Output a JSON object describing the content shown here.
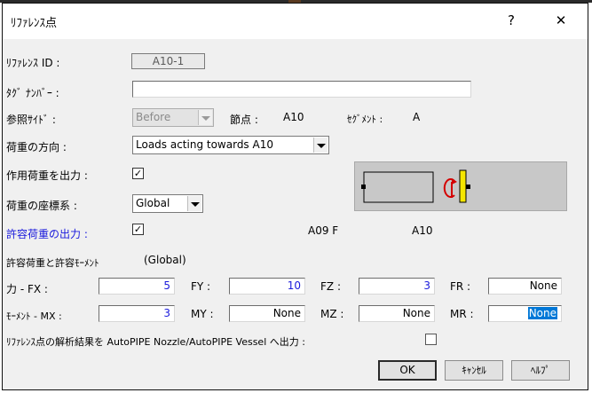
{
  "window": {
    "title": "ﾘﾌｧﾚﾝｽ点",
    "help_glyph": "?",
    "close_glyph": "✕"
  },
  "ref_id": {
    "label": "ﾘﾌｧﾚﾝｽ ID :",
    "value": "A10-1"
  },
  "tag_number": {
    "label": "ﾀｸﾞ ﾅﾝﾊﾞｰ :",
    "value": ""
  },
  "ref_side": {
    "label": "参照ｻｲﾄﾞ :",
    "value": "Before"
  },
  "node": {
    "label": "節点 :",
    "value": "A10"
  },
  "segment": {
    "label": "ｾｸﾞﾒﾝﾄ :",
    "value": "A"
  },
  "load_direction": {
    "label": "荷重の方向 :",
    "value": "Loads acting towards A10"
  },
  "output_applied_load": {
    "label": "作用荷重を出力 :",
    "checked": true
  },
  "load_coord_system": {
    "label": "荷重の座標系 :",
    "value": "Global"
  },
  "output_allowable_load": {
    "label": "許容荷重の出力 :",
    "checked": true,
    "left_node": "A09 F",
    "right_node": "A10"
  },
  "allowable_section": {
    "label": "許容荷重と許容ﾓｰﾒﾝﾄ",
    "system": "(Global)"
  },
  "force": {
    "row_label": "力  - FX :",
    "fx": "5",
    "fy_label": "FY :",
    "fy": "10",
    "fz_label": "FZ :",
    "fz": "3",
    "fr_label": "FR :",
    "fr": "None"
  },
  "moment": {
    "row_label": "ﾓｰﾒﾝﾄ - MX :",
    "mx": "3",
    "my_label": "MY :",
    "my": "None",
    "mz_label": "MZ :",
    "mz": "None",
    "mr_label": "MR :",
    "mr": "None"
  },
  "export": {
    "label": "ﾘﾌｧﾚﾝｽ点の解析結果を AutoPIPE Nozzle/AutoPIPE Vessel へ出力 :",
    "checked": false
  },
  "buttons": {
    "ok": "OK",
    "cancel": "ｷｬﾝｾﾙ",
    "help": "ﾍﾙﾌﾟ"
  },
  "colors": {
    "accent_blue": "#1a1adc",
    "selection": "#0078d7",
    "moment_arrow": "#d40000",
    "support_yellow": "#f5e600"
  }
}
